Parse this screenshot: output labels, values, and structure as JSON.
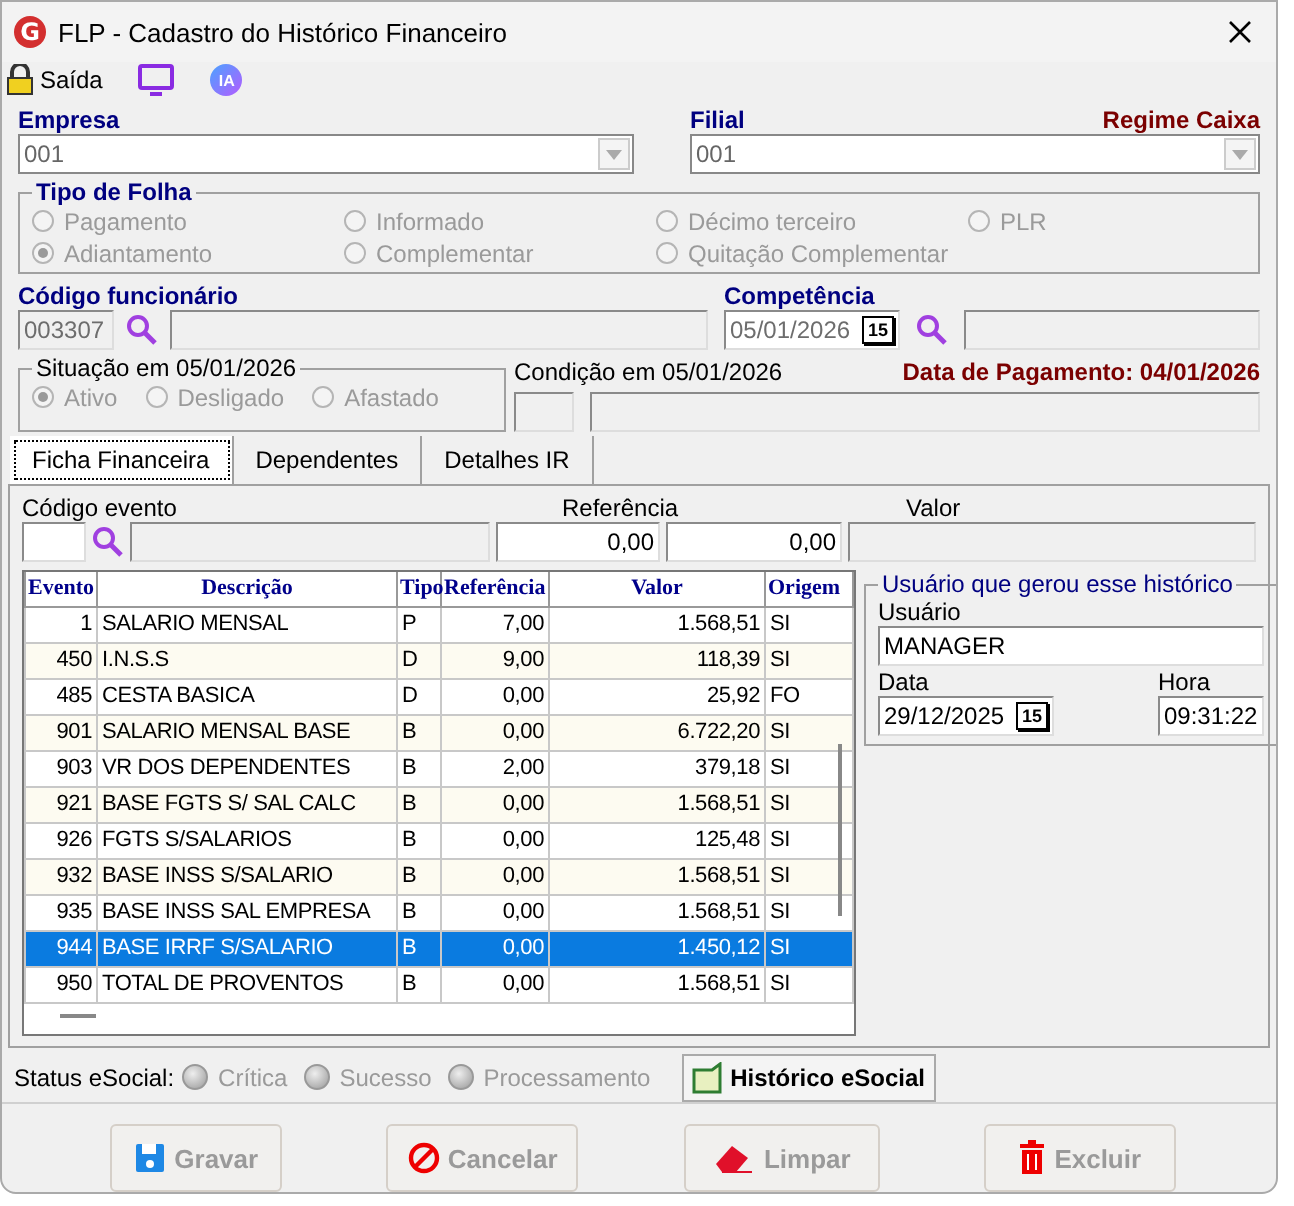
{
  "window": {
    "title": "FLP - Cadastro do Histórico Financeiro",
    "logo": "G"
  },
  "toolbar": [
    {
      "kind": "exit",
      "label": "Saída"
    },
    {
      "kind": "monitor"
    },
    {
      "kind": "ia",
      "label": "IA"
    }
  ],
  "empresa": {
    "label": "Empresa",
    "value": "001"
  },
  "filial": {
    "label": "Filial",
    "value": "001"
  },
  "regime": "Regime Caixa",
  "tipo_folha": {
    "title": "Tipo de Folha",
    "disabled": true,
    "options": [
      {
        "label": "Pagamento",
        "selected": false
      },
      {
        "label": "Informado",
        "selected": false
      },
      {
        "label": "Décimo terceiro",
        "selected": false
      },
      {
        "label": "PLR",
        "selected": false
      },
      {
        "label": "Adiantamento",
        "selected": true
      },
      {
        "label": "Complementar",
        "selected": false
      },
      {
        "label": "Quitação Complementar",
        "selected": false
      }
    ]
  },
  "funcionario": {
    "label": "Código funcionário",
    "code": "003307"
  },
  "competencia": {
    "label": "Competência",
    "value": "05/01/2026",
    "calendar": "15"
  },
  "situacao": {
    "title": "Situação em  05/01/2026",
    "disabled": true,
    "options": [
      {
        "label": "Ativo",
        "selected": true
      },
      {
        "label": "Desligado",
        "selected": false
      },
      {
        "label": "Afastado",
        "selected": false
      }
    ]
  },
  "condicao": {
    "label": "Condição em 05/01/2026"
  },
  "data_pagamento": "Data de Pagamento: 04/01/2026",
  "tabs": [
    {
      "label": "Ficha Financeira",
      "selected": true
    },
    {
      "label": "Dependentes",
      "selected": false
    },
    {
      "label": "Detalhes IR",
      "selected": false
    }
  ],
  "evento_form": {
    "codigo_label": "Código evento",
    "referencia_label": "Referência",
    "referencia_value": "0,00",
    "valor_label": "Valor",
    "valor_value": "0,00"
  },
  "table": {
    "columns": [
      "Evento",
      "Descrição",
      "Tipo",
      "Referência",
      "Valor",
      "Origem"
    ],
    "rows": [
      {
        "cells": [
          "1",
          "SALARIO MENSAL",
          "P",
          "7,00",
          "1.568,51",
          "SI"
        ],
        "selected": false
      },
      {
        "cells": [
          "450",
          "I.N.S.S",
          "D",
          "9,00",
          "118,39",
          "SI"
        ],
        "selected": false
      },
      {
        "cells": [
          "485",
          "CESTA BASICA",
          "D",
          "0,00",
          "25,92",
          "FO"
        ],
        "selected": false
      },
      {
        "cells": [
          "901",
          "SALARIO MENSAL BASE",
          "B",
          "0,00",
          "6.722,20",
          "SI"
        ],
        "selected": false
      },
      {
        "cells": [
          "903",
          "VR DOS DEPENDENTES",
          "B",
          "2,00",
          "379,18",
          "SI"
        ],
        "selected": false
      },
      {
        "cells": [
          "921",
          "BASE FGTS S/ SAL CALC",
          "B",
          "0,00",
          "1.568,51",
          "SI"
        ],
        "selected": false
      },
      {
        "cells": [
          "926",
          "FGTS S/SALARIOS",
          "B",
          "0,00",
          "125,48",
          "SI"
        ],
        "selected": false
      },
      {
        "cells": [
          "932",
          "BASE INSS S/SALARIO",
          "B",
          "0,00",
          "1.568,51",
          "SI"
        ],
        "selected": false
      },
      {
        "cells": [
          "935",
          "BASE INSS SAL EMPRESA",
          "B",
          "0,00",
          "1.568,51",
          "SI"
        ],
        "selected": false
      },
      {
        "cells": [
          "944",
          "BASE IRRF S/SALARIO",
          "B",
          "0,00",
          "1.450,12",
          "SI"
        ],
        "selected": true
      },
      {
        "cells": [
          "950",
          "TOTAL DE PROVENTOS",
          "B",
          "0,00",
          "1.568,51",
          "SI"
        ],
        "selected": false
      }
    ]
  },
  "usuario_panel": {
    "title": "Usuário que gerou esse histórico",
    "usuario_label": "Usuário",
    "usuario_value": "MANAGER",
    "data_label": "Data",
    "data_value": "29/12/2025",
    "calendar": "15",
    "hora_label": "Hora",
    "hora_value": "09:31:22"
  },
  "status": {
    "label": "Status eSocial:",
    "options": [
      {
        "label": "Crítica",
        "selected": false
      },
      {
        "label": "Sucesso",
        "selected": false
      },
      {
        "label": "Processamento",
        "selected": false
      }
    ],
    "historico_button": "Histórico eSocial"
  },
  "buttons": [
    {
      "kind": "save",
      "label": "Gravar"
    },
    {
      "kind": "cancel",
      "label": "Cancelar"
    },
    {
      "kind": "clear",
      "label": "Limpar"
    },
    {
      "kind": "delete",
      "label": "Excluir"
    }
  ]
}
